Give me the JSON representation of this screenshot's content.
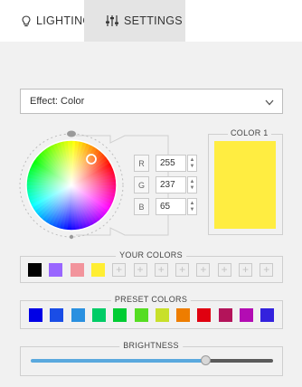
{
  "tabs": {
    "lighting": {
      "label": "LIGHTING",
      "icon": "bulb-icon"
    },
    "settings": {
      "label": "SETTINGS",
      "icon": "sliders-icon"
    }
  },
  "effect": {
    "label": "Effect: Color"
  },
  "rgb": [
    {
      "letter": "R",
      "value": "255"
    },
    {
      "letter": "G",
      "value": "237"
    },
    {
      "letter": "B",
      "value": "65"
    }
  ],
  "color1": {
    "label": "COLOR 1",
    "color": "#FFED41"
  },
  "your_colors": {
    "label": "YOUR COLORS",
    "swatches": [
      "#000000",
      "#9966ff",
      "#f2949c",
      "#ffee33"
    ],
    "add_slots": 8
  },
  "preset_colors": {
    "label": "PRESET COLORS",
    "swatches": [
      "#0000e6",
      "#1a4de6",
      "#2a90e0",
      "#00cc66",
      "#00cc33",
      "#55dd22",
      "#c8e02a",
      "#ee7d00",
      "#e00010",
      "#b3145a",
      "#b30cb3",
      "#3322dd"
    ]
  },
  "brightness": {
    "label": "BRIGHTNESS",
    "value": 0.72
  }
}
